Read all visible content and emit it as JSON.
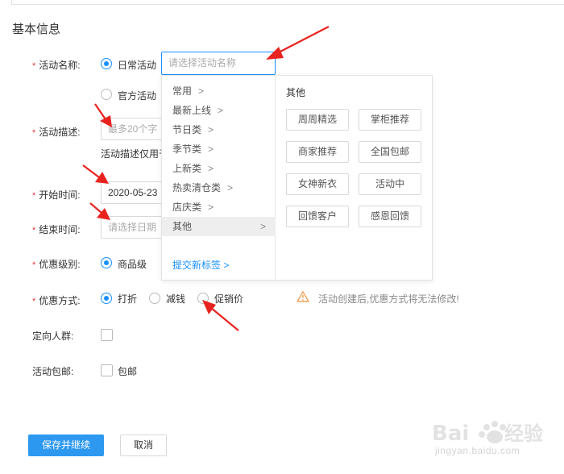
{
  "section_title": "基本信息",
  "fields": {
    "name": {
      "label": "活动名称:",
      "options": [
        "日常活动",
        "官方活动"
      ],
      "input_placeholder": "请选择活动名称"
    },
    "desc": {
      "label": "活动描述:",
      "placeholder": "最多20个字",
      "hint": "活动描述仅用于"
    },
    "start": {
      "label": "开始时间:",
      "value": "2020-05-23"
    },
    "end": {
      "label": "结束时间:",
      "placeholder": "请选择日期"
    },
    "level": {
      "label": "优惠级别:",
      "option": "商品级"
    },
    "method": {
      "label": "优惠方式:",
      "options": [
        "打折",
        "减钱",
        "促销价"
      ],
      "warning": "活动创建后,优惠方式将无法修改!"
    },
    "crowd": {
      "label": "定向人群:"
    },
    "shipping": {
      "label": "活动包邮:",
      "checkbox_label": "包邮"
    }
  },
  "dropdown": {
    "categories": [
      {
        "label": "常用",
        "arrow": ">"
      },
      {
        "label": "最新上线",
        "arrow": ">"
      },
      {
        "label": "节日类",
        "arrow": ">"
      },
      {
        "label": "季节类",
        "arrow": ">"
      },
      {
        "label": "上新类",
        "arrow": ">"
      },
      {
        "label": "热卖清仓类",
        "arrow": ">"
      },
      {
        "label": "店庆类",
        "arrow": ">"
      },
      {
        "label": "其他",
        "arrow": ">"
      }
    ],
    "submit_link": "提交新标签 >",
    "panel_title": "其他",
    "tags": [
      "周周精选",
      "掌柜推荐",
      "商家推荐",
      "全国包邮",
      "女神新衣",
      "活动中",
      "回馈客户",
      "感恩回馈"
    ]
  },
  "buttons": {
    "save": "保存并继续",
    "cancel": "取消"
  },
  "watermark": {
    "text": "jingyan.baidu.com"
  },
  "colors": {
    "accent": "#1890ff",
    "required": "#e4393c",
    "annotation_arrow": "#e8231f",
    "primary_button": "#2d98f0"
  }
}
